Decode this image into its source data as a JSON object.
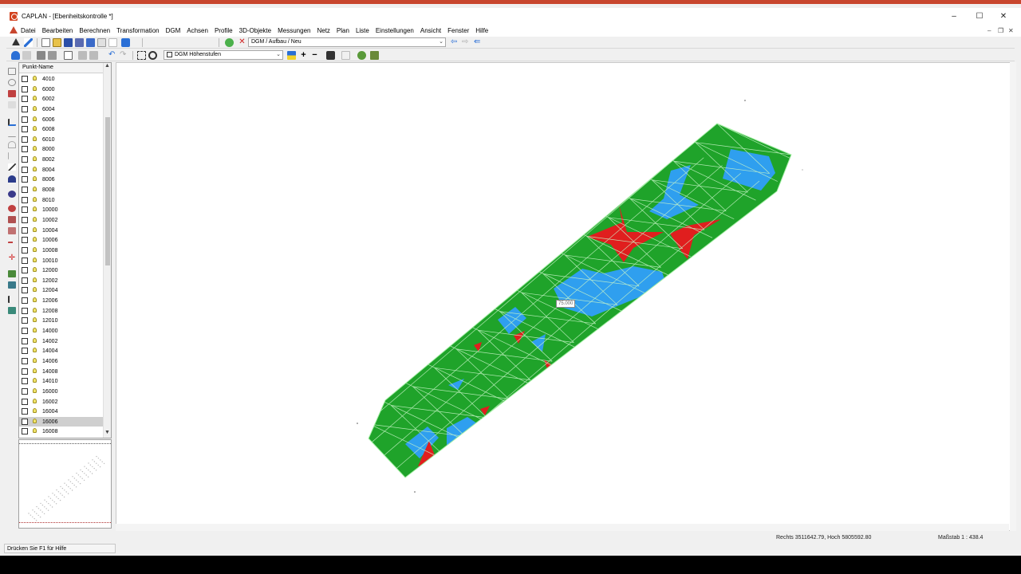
{
  "window": {
    "title": "CAPLAN - [Ebenheitskontrolle *]",
    "controls": {
      "minimize": "–",
      "maximize": "☐",
      "close": "✕"
    },
    "mdi_controls": {
      "minimize": "–",
      "restore": "❐",
      "close": "✕"
    }
  },
  "menu": [
    "Datei",
    "Bearbeiten",
    "Berechnen",
    "Transformation",
    "DGM",
    "Achsen",
    "Profile",
    "3D-Objekte",
    "Messungen",
    "Netz",
    "Plan",
    "Liste",
    "Einstellungen",
    "Ansicht",
    "Fenster",
    "Hilfe"
  ],
  "toolbar1": {
    "dgm_combo": "DGM / Aufbau / Neu"
  },
  "toolbar2": {
    "height_combo": "DGM Höhenstufen"
  },
  "point_list": {
    "header": "Punkt-Name",
    "selected_index": 34,
    "items": [
      "4010",
      "6000",
      "6002",
      "6004",
      "6006",
      "6008",
      "6010",
      "8000",
      "8002",
      "8004",
      "8006",
      "8008",
      "8010",
      "10000",
      "10002",
      "10004",
      "10006",
      "10008",
      "10010",
      "12000",
      "12002",
      "12004",
      "12006",
      "12008",
      "12010",
      "14000",
      "14002",
      "14004",
      "14006",
      "14008",
      "14010",
      "16000",
      "16002",
      "16004",
      "16006",
      "16008"
    ]
  },
  "canvas": {
    "elevation_label": "75.000",
    "colors": {
      "above": "#1fa32a",
      "within": "#2f9fef",
      "below": "#e01e1e",
      "mesh": "#c8f5c8"
    }
  },
  "status": {
    "help": "Drücken Sie F1 für Hilfe",
    "coordinates": "Rechts 3511642.79, Hoch 5805592.80",
    "scale": "Maßstab 1 : 438.4"
  }
}
